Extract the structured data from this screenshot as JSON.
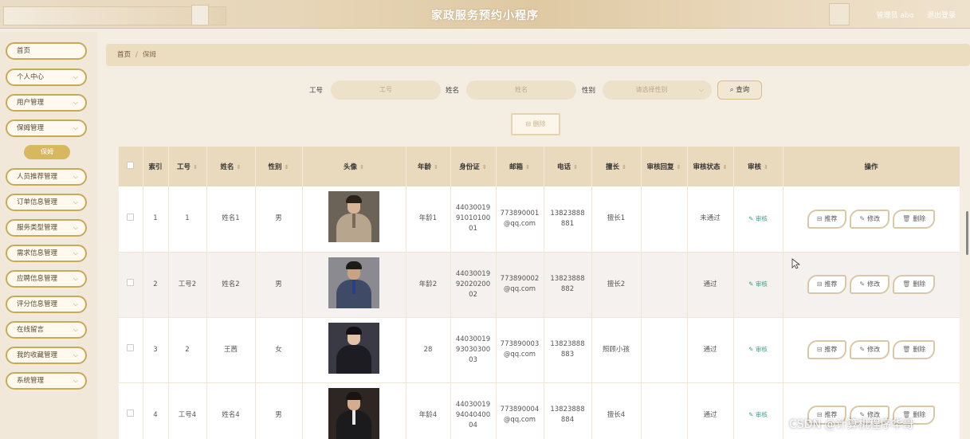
{
  "header": {
    "app_title": "家政服务预约小程序",
    "user_label": "管理员 abo",
    "logout_label": "退出登录"
  },
  "sidebar": {
    "items": [
      {
        "label": "首页",
        "has_chevron": false
      },
      {
        "label": "个人中心",
        "has_chevron": true
      },
      {
        "label": "用户管理",
        "has_chevron": true
      },
      {
        "label": "保姆管理",
        "has_chevron": true
      },
      {
        "label": "人员推荐管理",
        "has_chevron": true
      },
      {
        "label": "订单信息管理",
        "has_chevron": true
      },
      {
        "label": "服务类型管理",
        "has_chevron": true
      },
      {
        "label": "需求信息管理",
        "has_chevron": true
      },
      {
        "label": "应聘信息管理",
        "has_chevron": true
      },
      {
        "label": "评分信息管理",
        "has_chevron": true
      },
      {
        "label": "在线留言",
        "has_chevron": true
      },
      {
        "label": "我的收藏管理",
        "has_chevron": true
      },
      {
        "label": "系统管理",
        "has_chevron": true
      }
    ],
    "active_sub": "保姆",
    "chevron_icon": "chevron-down-icon"
  },
  "breadcrumb": {
    "home": "首页",
    "separator": "/",
    "current": "保姆"
  },
  "search": {
    "job_no_label": "工号",
    "job_no_placeholder": "工号",
    "name_label": "姓名",
    "name_placeholder": "姓名",
    "gender_label": "性别",
    "gender_placeholder": "请选择性别",
    "search_button": "查询"
  },
  "toolbar": {
    "delete_label": "删除"
  },
  "table": {
    "columns": [
      "索引",
      "工号",
      "姓名",
      "性别",
      "头像",
      "年龄",
      "身份证",
      "邮箱",
      "电话",
      "擅长",
      "审核回复",
      "审核状态",
      "审核",
      "操作"
    ],
    "sortable": [
      false,
      true,
      true,
      true,
      true,
      true,
      true,
      true,
      true,
      true,
      true,
      true,
      true,
      false
    ],
    "rows": [
      {
        "index": "1",
        "job_no": "1",
        "name": "姓名1",
        "gender": "男",
        "age": "年龄1",
        "id_card": "440300199101010001",
        "email": "773890001@qq.com",
        "phone": "13823888881",
        "skill": "擅长1",
        "reply": "",
        "status": "未通过",
        "avatar": "man-suit-light"
      },
      {
        "index": "2",
        "job_no": "工号2",
        "name": "姓名2",
        "gender": "男",
        "age": "年龄2",
        "id_card": "440300199202020002",
        "email": "773890002@qq.com",
        "phone": "13823888882",
        "skill": "擅长2",
        "reply": "",
        "status": "通过",
        "avatar": "man-suit-blue"
      },
      {
        "index": "3",
        "job_no": "2",
        "name": "王茜",
        "gender": "女",
        "age": "28",
        "id_card": "440300199303030003",
        "email": "773890003@qq.com",
        "phone": "13823888883",
        "skill": "照顾小孩",
        "reply": "",
        "status": "通过",
        "avatar": "woman-dark"
      },
      {
        "index": "4",
        "job_no": "工号4",
        "name": "姓名4",
        "gender": "男",
        "age": "年龄4",
        "id_card": "440300199404040004",
        "email": "773890004@qq.com",
        "phone": "13823888884",
        "skill": "擅长4",
        "reply": "",
        "status": "通过",
        "avatar": "man-suit-dark"
      }
    ],
    "audit_link": "审核",
    "actions": {
      "recommend": "推荐",
      "edit": "修改",
      "delete": "删除"
    }
  },
  "watermark": "CSDN @计算机程序华哥",
  "colors": {
    "accent_gold": "#c9a856",
    "header_bg": "#e9d9bd",
    "audit_link": "#3aa28e"
  }
}
